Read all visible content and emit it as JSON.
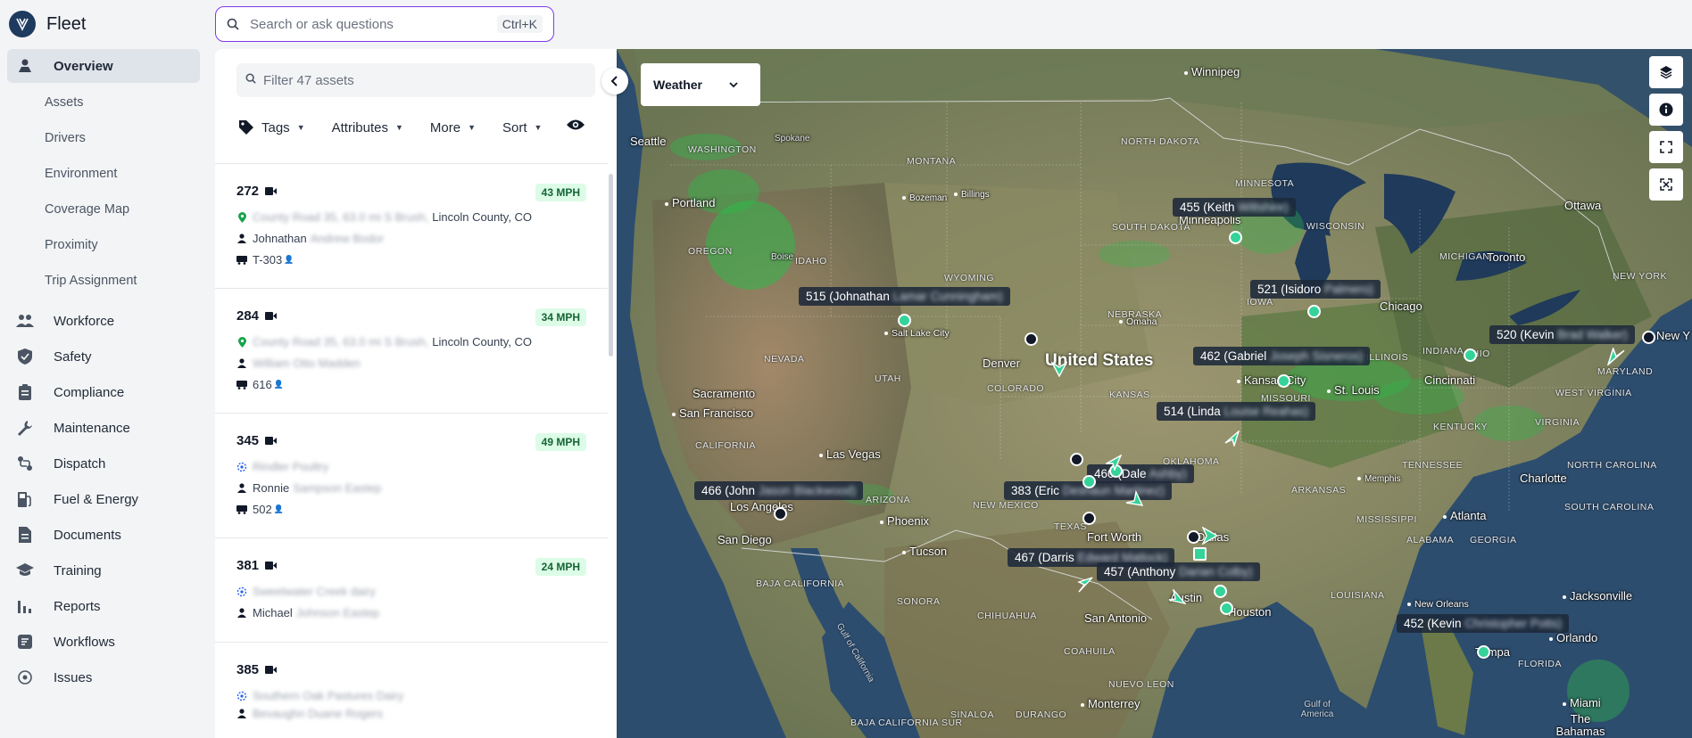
{
  "app": {
    "name": "Fleet"
  },
  "search": {
    "placeholder": "Search or ask questions",
    "shortcut": "Ctrl+K"
  },
  "nav": {
    "overview": "Overview",
    "sub": [
      "Assets",
      "Drivers",
      "Environment",
      "Coverage Map",
      "Proximity",
      "Trip Assignment"
    ],
    "items": [
      {
        "label": "Workforce",
        "icon": "people-icon"
      },
      {
        "label": "Safety",
        "icon": "shield-icon"
      },
      {
        "label": "Compliance",
        "icon": "clipboard-icon"
      },
      {
        "label": "Maintenance",
        "icon": "wrench-icon"
      },
      {
        "label": "Dispatch",
        "icon": "route-icon"
      },
      {
        "label": "Fuel & Energy",
        "icon": "fuel-icon"
      },
      {
        "label": "Documents",
        "icon": "document-icon"
      },
      {
        "label": "Training",
        "icon": "graduation-cap-icon"
      },
      {
        "label": "Reports",
        "icon": "bar-chart-icon"
      },
      {
        "label": "Workflows",
        "icon": "workflow-icon"
      },
      {
        "label": "Issues",
        "icon": "issue-icon"
      }
    ]
  },
  "panel": {
    "filter_placeholder": "Filter 47 assets",
    "toolbar": {
      "tags": "Tags",
      "attributes": "Attributes",
      "more": "More",
      "sort": "Sort"
    },
    "assets": [
      {
        "id": "272",
        "speed": "43 MPH",
        "loc_blur": "County Road 35, 63.0 mi S Brush,",
        "loc": "Lincoln County, CO",
        "driver": "Johnathan",
        "driver_blur": "Andrew Bodor",
        "trailer": "T-303"
      },
      {
        "id": "284",
        "speed": "34 MPH",
        "loc_blur": "County Road 35, 63.0 mi S Brush,",
        "loc": "Lincoln County, CO",
        "driver": "",
        "driver_blur": "William Otto Madden",
        "trailer": "616"
      },
      {
        "id": "345",
        "speed": "49 MPH",
        "loc_blur": "Rindler Poultry",
        "loc": "",
        "driver": "Ronnie",
        "driver_blur": "Sampson Eastep",
        "trailer": "502"
      },
      {
        "id": "381",
        "speed": "24 MPH",
        "loc_blur": "Sweetwater Creek dairy",
        "loc": "",
        "driver": "Michael",
        "driver_blur": "Johnson Eastep",
        "trailer": ""
      },
      {
        "id": "385",
        "speed": "",
        "loc_blur": "Southern Oak Pastures Dairy",
        "loc": "",
        "driver": "",
        "driver_blur": "Bevaughn Duane Rogers",
        "trailer": ""
      }
    ]
  },
  "map": {
    "weather_label": "Weather",
    "country": "United States",
    "cities": [
      {
        "n": "Winnipeg"
      },
      {
        "n": "Seattle"
      },
      {
        "n": "Spokane"
      },
      {
        "n": "Portland"
      },
      {
        "n": "Bozeman"
      },
      {
        "n": "Billings"
      },
      {
        "n": "Boise"
      },
      {
        "n": "Salt Lake City"
      },
      {
        "n": "Denver"
      },
      {
        "n": "Minneapolis"
      },
      {
        "n": "Omaha"
      },
      {
        "n": "Kansas City"
      },
      {
        "n": "St. Louis"
      },
      {
        "n": "Chicago"
      },
      {
        "n": "Toronto"
      },
      {
        "n": "Ottawa"
      },
      {
        "n": "Cincinnati"
      },
      {
        "n": "New Y"
      },
      {
        "n": "Sacramento"
      },
      {
        "n": "San Francisco"
      },
      {
        "n": "Las Vegas"
      },
      {
        "n": "Los Angeles"
      },
      {
        "n": "San Diego"
      },
      {
        "n": "Phoenix"
      },
      {
        "n": "Tucson"
      },
      {
        "n": "Fort Worth"
      },
      {
        "n": "Dallas"
      },
      {
        "n": "Austin"
      },
      {
        "n": "Houston"
      },
      {
        "n": "San Antonio"
      },
      {
        "n": "Monterrey"
      },
      {
        "n": "Memphis"
      },
      {
        "n": "Atlanta"
      },
      {
        "n": "Charlotte"
      },
      {
        "n": "Jacksonville"
      },
      {
        "n": "New Orleans"
      },
      {
        "n": "Orlando"
      },
      {
        "n": "Tampa"
      },
      {
        "n": "Miami"
      },
      {
        "n": "The Bahamas"
      }
    ],
    "states": [
      "WASHINGTON",
      "OREGON",
      "IDAHO",
      "MONTANA",
      "WYOMING",
      "NEVADA",
      "UTAH",
      "COLORADO",
      "CALIFORNIA",
      "ARIZONA",
      "NEW MEXICO",
      "NORTH DAKOTA",
      "SOUTH DAKOTA",
      "NEBRASKA",
      "KANSAS",
      "OKLAHOMA",
      "MINNESOTA",
      "WISCONSIN",
      "IOWA",
      "MISSOURI",
      "ARKANSAS",
      "ILLINOIS",
      "INDIANA",
      "OHIO",
      "MICHIGAN",
      "KENTUCKY",
      "TENNESSEE",
      "MISSISSIPPI",
      "ALABAMA",
      "GEORGIA",
      "LOUISIANA",
      "FLORIDA",
      "VIRGINIA",
      "WEST VIRGINIA",
      "NORTH CAROLINA",
      "SOUTH CAROLINA",
      "MARYLAND",
      "NEW YORK",
      "TEXAS",
      "BAJA CALIFORNIA",
      "SONORA",
      "CHIHUAHUA",
      "COAHUILA",
      "NUEVO LEON",
      "SINALOA",
      "DURANGO",
      "BAJA CALIFORNIA SUR"
    ],
    "seas": [
      "Gulf of California",
      "Gulf of America"
    ],
    "labels": [
      {
        "t": "455 (Keith",
        "b": "Wiltshire)"
      },
      {
        "t": "521 (Isidoro",
        "b": "Palmero)"
      },
      {
        "t": "515 (Johnathan",
        "b": "Lamar Cunningham)"
      },
      {
        "t": "462 (Gabriel",
        "b": "Joseph Sisneros)"
      },
      {
        "t": "520 (Kevin",
        "b": "Brad Walker)"
      },
      {
        "t": "514 (Linda",
        "b": "Louise Reahas)"
      },
      {
        "t": "460 (Dale",
        "b": "Ashby)"
      },
      {
        "t": "383 (Eric",
        "b": "Deshaun Martinez)"
      },
      {
        "t": "466 (John",
        "b": "Jason Blackwood)"
      },
      {
        "t": "467 (Darris",
        "b": "Edward Matlock)"
      },
      {
        "t": "457 (Anthony",
        "b": "Darian Colby)"
      },
      {
        "t": "452 (Kevin",
        "b": "Christopher Potts)"
      }
    ]
  }
}
